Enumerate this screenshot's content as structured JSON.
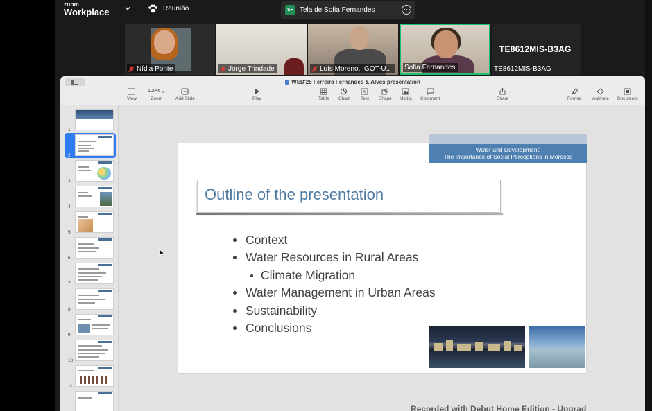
{
  "app": {
    "brand_top": "zoom",
    "brand_bottom": "Workplace",
    "meeting_label": "Reunião"
  },
  "share": {
    "initials": "SF",
    "label": "Tela de Sofia Fernandes"
  },
  "participants": [
    {
      "name": "Nídia Ponte",
      "muted": true
    },
    {
      "name": "Jorge Trindade",
      "muted": true
    },
    {
      "name": "Luís Moreno, IGOT-U...",
      "muted": true
    },
    {
      "name": "Sofia Fernandes",
      "muted": false,
      "active_speaker": true
    },
    {
      "name": "TE8612MIS-B3AG",
      "big_label": "TE8612MIS-B3AG",
      "muted": false
    }
  ],
  "keynote": {
    "title": "WSD'25 Ferreira Fernandes & Alves presentation",
    "toolbar": [
      {
        "label": "View",
        "icon": "sidebar-icon"
      },
      {
        "label": "Zoom",
        "value": "100%",
        "icon": "zoom-menu"
      },
      {
        "label": "Add Slide",
        "icon": "add-slide-icon"
      },
      {
        "label": "Play",
        "icon": "play-icon"
      },
      {
        "label": "Table",
        "icon": "table-icon"
      },
      {
        "label": "Chart",
        "icon": "chart-icon"
      },
      {
        "label": "Text",
        "icon": "text-icon"
      },
      {
        "label": "Shape",
        "icon": "shape-icon"
      },
      {
        "label": "Media",
        "icon": "media-icon"
      },
      {
        "label": "Comment",
        "icon": "comment-icon"
      },
      {
        "label": "Share",
        "icon": "share-icon"
      },
      {
        "label": "Format",
        "icon": "format-icon"
      },
      {
        "label": "Animate",
        "icon": "animate-icon"
      },
      {
        "label": "Document",
        "icon": "document-icon"
      }
    ],
    "slide_numbers": [
      "1",
      "2",
      "3",
      "4",
      "5",
      "6",
      "7",
      "8",
      "9",
      "10",
      "11"
    ],
    "selected_slide": "2"
  },
  "slide": {
    "banner_line1": "Water and Development:",
    "banner_line2": "The Importance of Social Perceptions in Morocco",
    "heading": "Outline of the presentation",
    "bullets": [
      {
        "text": "Context",
        "level": 1
      },
      {
        "text": "Water Resources in Rural Areas",
        "level": 1
      },
      {
        "text": "Climate Migration",
        "level": 2
      },
      {
        "text": "Water Management in Urban Areas",
        "level": 1
      },
      {
        "text": "Sustainability",
        "level": 1
      },
      {
        "text": "Conclusions",
        "level": 1
      }
    ]
  },
  "footer": {
    "partial_text": "Recorded with Debut Home Edition - Upgrad"
  },
  "colors": {
    "accent_speaker": "#1dbf73",
    "slide_heading": "#4f7ba3",
    "banner": "#4e7fb1",
    "selection": "#2f7bf2"
  }
}
